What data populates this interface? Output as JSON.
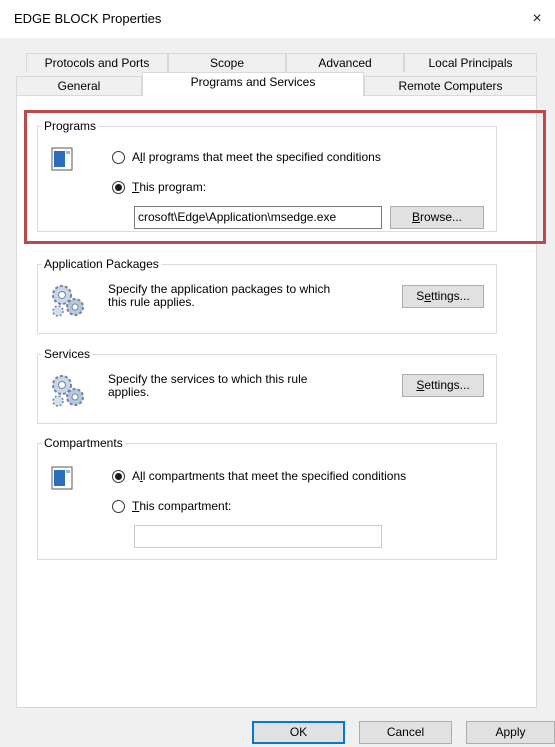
{
  "window": {
    "title": "EDGE BLOCK Properties",
    "close_glyph": "×"
  },
  "tabs": {
    "row1": [
      "Protocols and Ports",
      "Scope",
      "Advanced",
      "Local Principals"
    ],
    "row2": [
      "General",
      "Programs and Services",
      "Remote Computers"
    ],
    "active": "Programs and Services"
  },
  "programs": {
    "group_label": "Programs",
    "option_all": {
      "prefix": "A",
      "underline": "l",
      "rest": "l programs that meet the specified conditions",
      "checked": false
    },
    "option_this": {
      "prefix": "",
      "underline": "T",
      "rest": "his program:",
      "checked": true
    },
    "program_path": "crosoft\\Edge\\Application\\msedge.exe",
    "browse": {
      "underline": "B",
      "rest": "rowse..."
    }
  },
  "app_packages": {
    "group_label": "Application Packages",
    "description_line1": "Specify the application packages to which",
    "description_line2": "this rule applies.",
    "settings": {
      "prefix": "S",
      "underline": "e",
      "rest": "ttings..."
    }
  },
  "services": {
    "group_label": "Services",
    "description_line1": "Specify the services to which this rule",
    "description_line2": "applies.",
    "settings": {
      "prefix": "",
      "underline": "S",
      "rest": "ettings..."
    }
  },
  "compartments": {
    "group_label": "Compartments",
    "option_all": {
      "prefix": "A",
      "underline": "l",
      "rest": "l compartments that meet the specified conditions",
      "checked": true
    },
    "option_this": {
      "prefix": "",
      "underline": "T",
      "rest": "his compartment:",
      "checked": false
    },
    "compartment_value": ""
  },
  "footer": {
    "ok": "OK",
    "cancel": "Cancel",
    "apply": "Apply"
  },
  "colors": {
    "highlight_border": "#b84b4b",
    "default_button_border": "#0078d7",
    "icon_blue": "#2a6ebb"
  },
  "icons": [
    "program-window-icon",
    "gear-cluster-icon",
    "close-icon"
  ]
}
